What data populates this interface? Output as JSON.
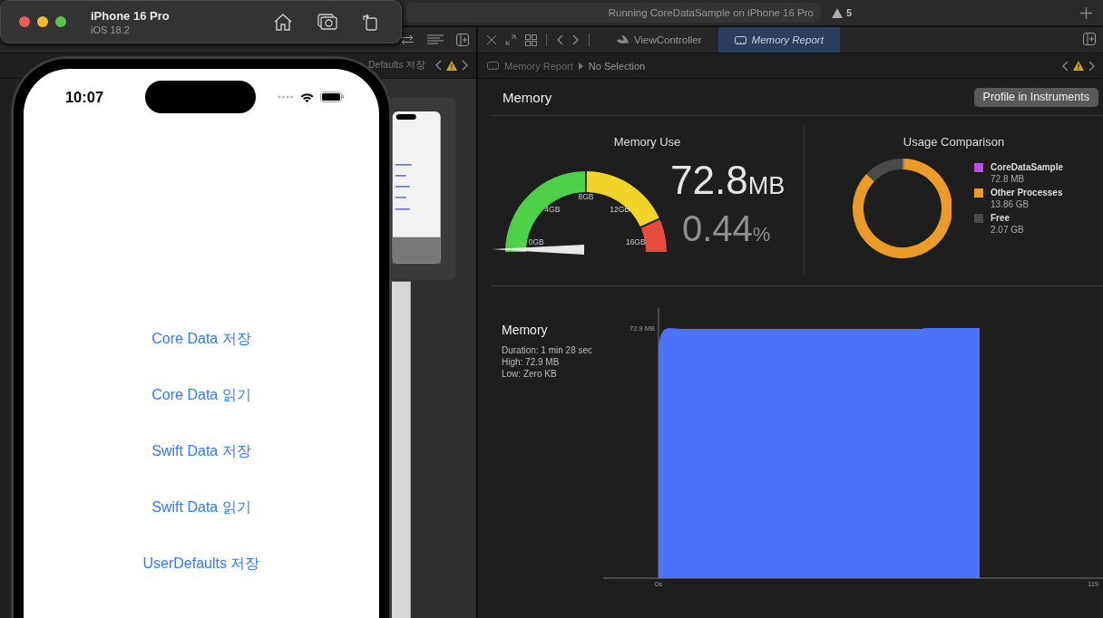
{
  "toolbar": {
    "activity": "Running CoreDataSample on iPhone 16 Pro",
    "warning_count": "5"
  },
  "simulator": {
    "device": "iPhone 16 Pro",
    "os": "iOS 18.2"
  },
  "phone": {
    "time": "10:07",
    "buttons": [
      "Core Data 저장",
      "Core Data 읽기",
      "Swift Data 저장",
      "Swift Data 읽기",
      "UserDefaults 저장"
    ]
  },
  "editor": {
    "breadcrumb": "Defaults 저장"
  },
  "tabs": [
    {
      "label": "ViewController",
      "selected": false,
      "kind": "swift"
    },
    {
      "label": "Memory Report",
      "selected": true,
      "kind": "gauge"
    }
  ],
  "breadcrumb": {
    "parent": "Memory Report",
    "current": "No Selection"
  },
  "report": {
    "title": "Memory",
    "profile_button": "Profile in Instruments",
    "memory_use": {
      "title": "Memory Use",
      "gauge_labels": [
        "0GB",
        "4GB",
        "8GB",
        "12GB",
        "16GB"
      ],
      "value": "72.8",
      "unit": "MB",
      "percent": "0.44",
      "percent_unit": "%"
    },
    "usage": {
      "title": "Usage Comparison",
      "legend": [
        {
          "value": "72.8 MB",
          "color": "#b452e8"
        },
        {
          "value": "13.86 GB",
          "color": "#eb9c28"
        },
        {
          "value": "2.07 GB",
          "color": "#4a4a4a"
        }
      ],
      "chart_data": {
        "type": "donut",
        "categories": [
          "CoreDataSample",
          "Other Processes",
          "Free"
        ],
        "values": [
          0.46,
          86.67,
          12.87
        ]
      }
    },
    "graph": {
      "title": "Memory",
      "details": [
        "Duration: 1 min 28 sec",
        "High: 72.9 MB",
        "Low: Zero KB"
      ],
      "y_label": "72.9 MB",
      "x_labels": [
        "0s",
        "119"
      ]
    }
  }
}
